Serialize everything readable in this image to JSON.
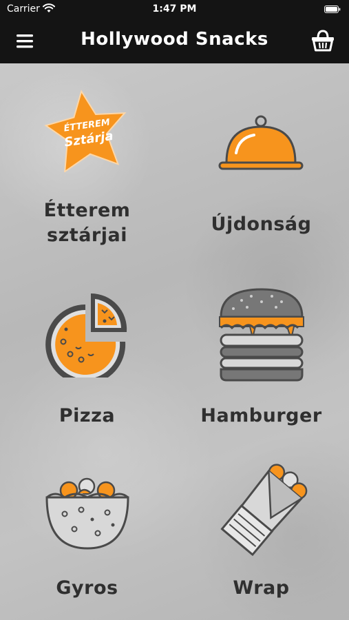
{
  "status_bar": {
    "carrier": "Carrier",
    "time": "1:47 PM",
    "wifi_icon": "wifi-icon",
    "battery_icon": "battery-icon"
  },
  "nav_bar": {
    "title": "Hollywood Snacks",
    "menu_icon": "hamburger-menu-icon",
    "cart_icon": "basket-icon"
  },
  "categories": [
    {
      "label_line1": "Étterem",
      "label_line2": "sztárjai",
      "icon": "star-badge-icon",
      "badge_text_1": "ÉTTEREM",
      "badge_text_2": "Sztárja"
    },
    {
      "label": "Újdonság",
      "icon": "cloche-icon"
    },
    {
      "label": "Pizza",
      "icon": "pizza-icon"
    },
    {
      "label": "Hamburger",
      "icon": "burger-icon"
    },
    {
      "label": "Gyros",
      "icon": "gyros-bowl-icon"
    },
    {
      "label": "Wrap",
      "icon": "wrap-icon"
    }
  ],
  "colors": {
    "accent": "#f7941d",
    "dark": "#141414",
    "icon_stroke": "#4a4a4a",
    "label": "#2f2f2f"
  }
}
